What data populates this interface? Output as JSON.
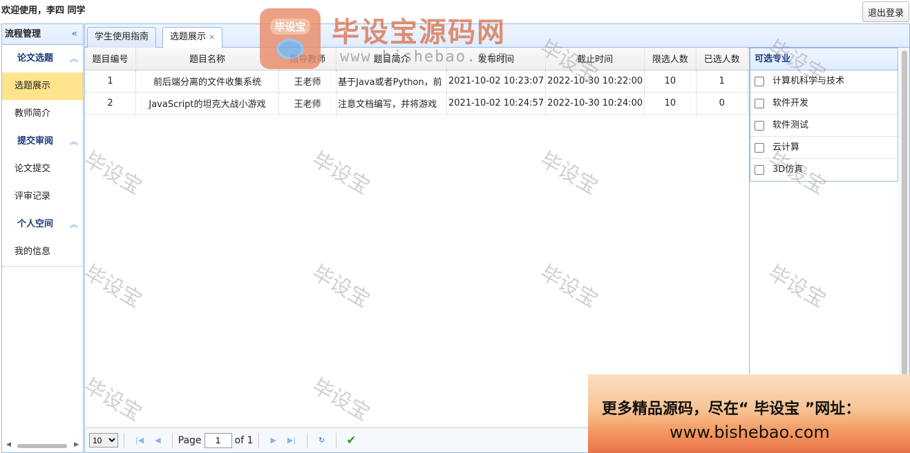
{
  "header": {
    "welcome": "欢迎使用，李四 同学",
    "logout": "退出登录"
  },
  "sidebar": {
    "title": "流程管理",
    "collapse_icon": "«",
    "sections": [
      {
        "label": "论文选题",
        "items": [
          "选题展示",
          "教师简介"
        ]
      },
      {
        "label": "提交审阅",
        "items": [
          "论文提交",
          "评审记录"
        ]
      },
      {
        "label": "个人空间",
        "items": [
          "我的信息"
        ]
      }
    ]
  },
  "tabs": [
    {
      "label": "学生使用指南"
    },
    {
      "label": "选题展示",
      "close": "×"
    }
  ],
  "table": {
    "columns": [
      "题目编号",
      "题目名称",
      "指导教师",
      "题目简介",
      "发布时间",
      "截止时间",
      "限选人数",
      "已选人数"
    ],
    "rows": [
      [
        "1",
        "前后端分离的文件收集系统",
        "王老师",
        "基于Java或者Python，前",
        "2021-10-02 10:23:07",
        "2022-10-30 10:22:00",
        "10",
        "1"
      ],
      [
        "2",
        "JavaScript的坦克大战小游戏",
        "王老师",
        "注意文档编写，并将游戏",
        "2021-10-02 10:24:57",
        "2022-10-30 10:24:00",
        "10",
        "0"
      ]
    ]
  },
  "majors": {
    "title": "可选专业",
    "items": [
      "计算机科学与技术",
      "软件开发",
      "软件测试",
      "云计算",
      "3D仿真"
    ]
  },
  "pager": {
    "page_size": "10",
    "page_label": "Page",
    "page": "1",
    "of_label": "of 1"
  },
  "watermark": {
    "logo_text": "毕设宝",
    "title": "毕设宝源码网",
    "url": "www.bishebao.com",
    "tile": "毕设宝"
  },
  "ad": {
    "line1": "更多精品源码，尽在“ 毕设宝 ”网址：",
    "line2": "www.bishebao.com"
  }
}
